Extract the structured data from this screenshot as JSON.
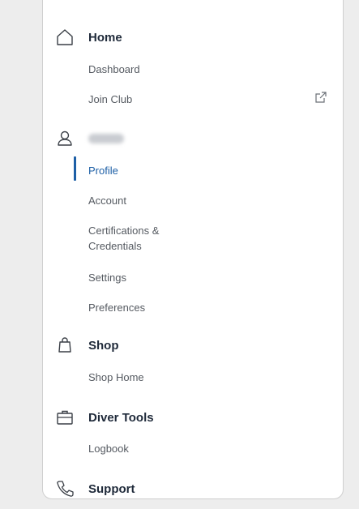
{
  "sections": {
    "home": {
      "icon": "home-icon",
      "title": "Home",
      "items": [
        "Dashboard",
        "Join Club"
      ],
      "join_club_icon": "external-link-icon"
    },
    "user": {
      "icon": "user-icon",
      "name_blurred": true,
      "items": [
        "Profile",
        "Account",
        "Certifications &",
        "Credentials",
        "Settings",
        "Preferences"
      ]
    },
    "shop": {
      "icon": "shopping-bag-icon",
      "title": "Shop",
      "items": [
        "Shop Home"
      ]
    },
    "diver_tools": {
      "icon": "briefcase-icon",
      "title": "Diver Tools",
      "items": [
        "Logbook"
      ]
    },
    "support": {
      "icon": "phone-icon",
      "title": "Support"
    }
  },
  "colors": {
    "active": "#1d5fa6",
    "title": "#1f2a3a",
    "sub": "#555a61",
    "background": "#ededed",
    "card": "#ffffff"
  },
  "active_item": "Profile"
}
